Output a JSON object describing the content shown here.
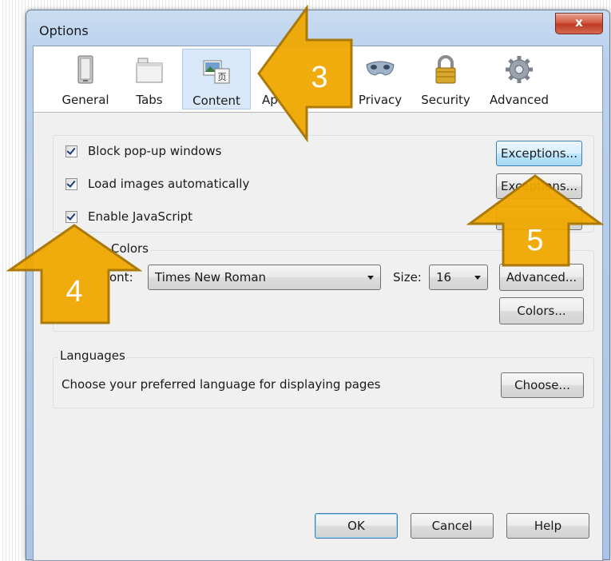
{
  "window": {
    "title": "Options",
    "close_glyph": "x"
  },
  "toolbar": {
    "panes": [
      {
        "label": "General",
        "icon": "general-icon"
      },
      {
        "label": "Tabs",
        "icon": "tabs-icon"
      },
      {
        "label": "Content",
        "icon": "content-icon",
        "selected": true
      },
      {
        "label": "Ap",
        "icon": "applications-icon"
      },
      {
        "label": "Privacy",
        "icon": "privacy-mask-icon"
      },
      {
        "label": "Security",
        "icon": "padlock-icon"
      },
      {
        "label": "Advanced",
        "icon": "gear-icon"
      }
    ]
  },
  "content": {
    "checkboxes": [
      {
        "label": "Block pop-up windows",
        "checked": true
      },
      {
        "label": "Load images automatically",
        "checked": true
      },
      {
        "label": "Enable JavaScript",
        "checked": true
      }
    ],
    "exceptions_label_1": "Exceptions...",
    "exceptions_label_2": "Exceptions..."
  },
  "fonts": {
    "legend": "Colors",
    "font_label": "ont:",
    "font_value": "Times New Roman",
    "size_label": "Size:",
    "size_value": "16",
    "advanced_label": "Advanced...",
    "colors_label": "Colors..."
  },
  "languages": {
    "legend": "Languages",
    "description": "Choose your preferred language for displaying pages",
    "choose_label": "Choose..."
  },
  "dialog_buttons": {
    "ok": "OK",
    "cancel": "Cancel",
    "help": "Help"
  },
  "callouts": [
    {
      "number": "3",
      "color": "#f0a800"
    },
    {
      "number": "4",
      "color": "#f0a800"
    },
    {
      "number": "5",
      "color": "#f0a800"
    }
  ]
}
